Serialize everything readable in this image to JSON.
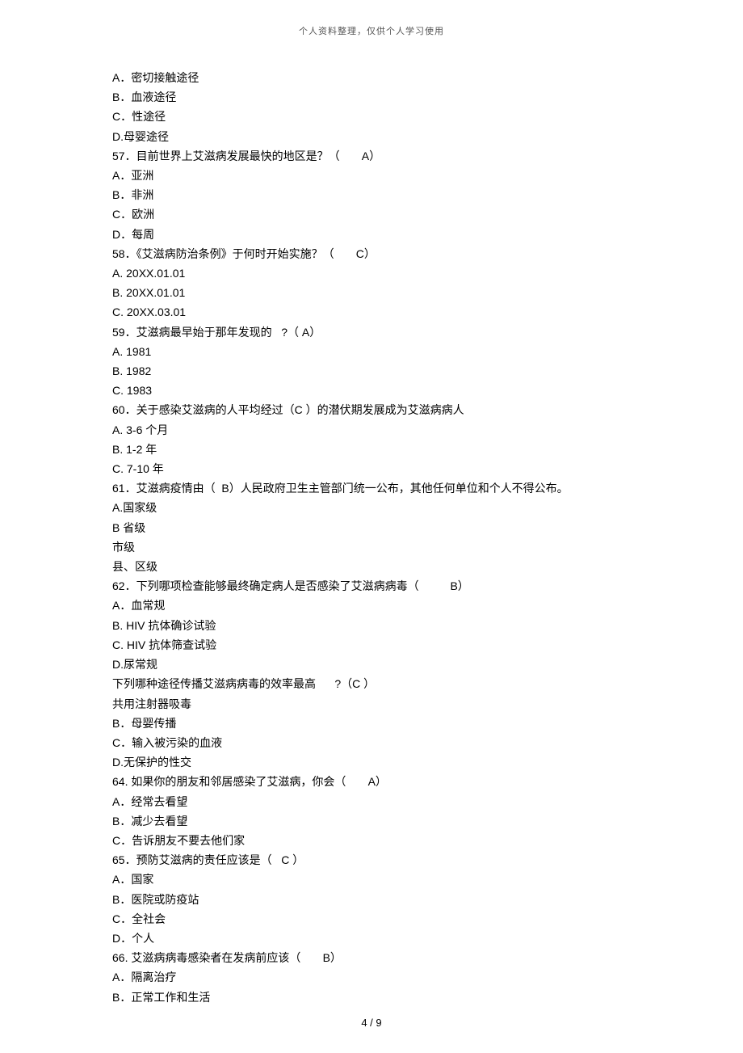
{
  "header": "个人资料整理，仅供个人学习使用",
  "footer": "4 / 9",
  "lines": [
    "A．密切接触途径",
    "B．血液途径",
    "C．性途径",
    "D.母婴途径",
    "57．目前世界上艾滋病发展最快的地区是？（       A）",
    "A．亚洲",
    "B．非洲",
    "C．欧洲",
    "D．每周",
    "58．《艾滋病防治条例》于何时开始实施？（       C）",
    "A. 20XX.01.01",
    "B. 20XX.01.01",
    "C. 20XX.03.01",
    "59．艾滋病最早始于那年发现的   ?（ A）",
    "A. 1981",
    "B. 1982",
    "C. 1983",
    "60．关于感染艾滋病的人平均经过（C ）的潜伏期发展成为艾滋病病人",
    "A. 3-6 个月",
    "B. 1-2 年",
    "C. 7-10 年",
    "61．艾滋病疫情由（  B）人民政府卫生主管部门统一公布，其他任何单位和个人不得公布。",
    "A.国家级",
    "B 省级",
    "市级",
    "县、区级",
    "62．下列哪项检查能够最终确定病人是否感染了艾滋病病毒（          B）",
    "A．血常规",
    "B. HIV 抗体确诊试验",
    "C. HIV 抗体筛查试验",
    "D.尿常规",
    "下列哪种途径传播艾滋病病毒的效率最高      ?（C ）",
    "共用注射器吸毒",
    "B．母婴传播",
    "C．输入被污染的血液",
    "D.无保护的性交",
    "64. 如果你的朋友和邻居感染了艾滋病，你会（       A）",
    "A．经常去看望",
    "B．减少去看望",
    "C．告诉朋友不要去他们家",
    "65．预防艾滋病的责任应该是（   C ）",
    "A．国家",
    "B．医院或防疫站",
    "C．全社会",
    "D．个人",
    "66. 艾滋病病毒感染者在发病前应该（       B）",
    "A．隔离治疗",
    "B．正常工作和生活"
  ]
}
